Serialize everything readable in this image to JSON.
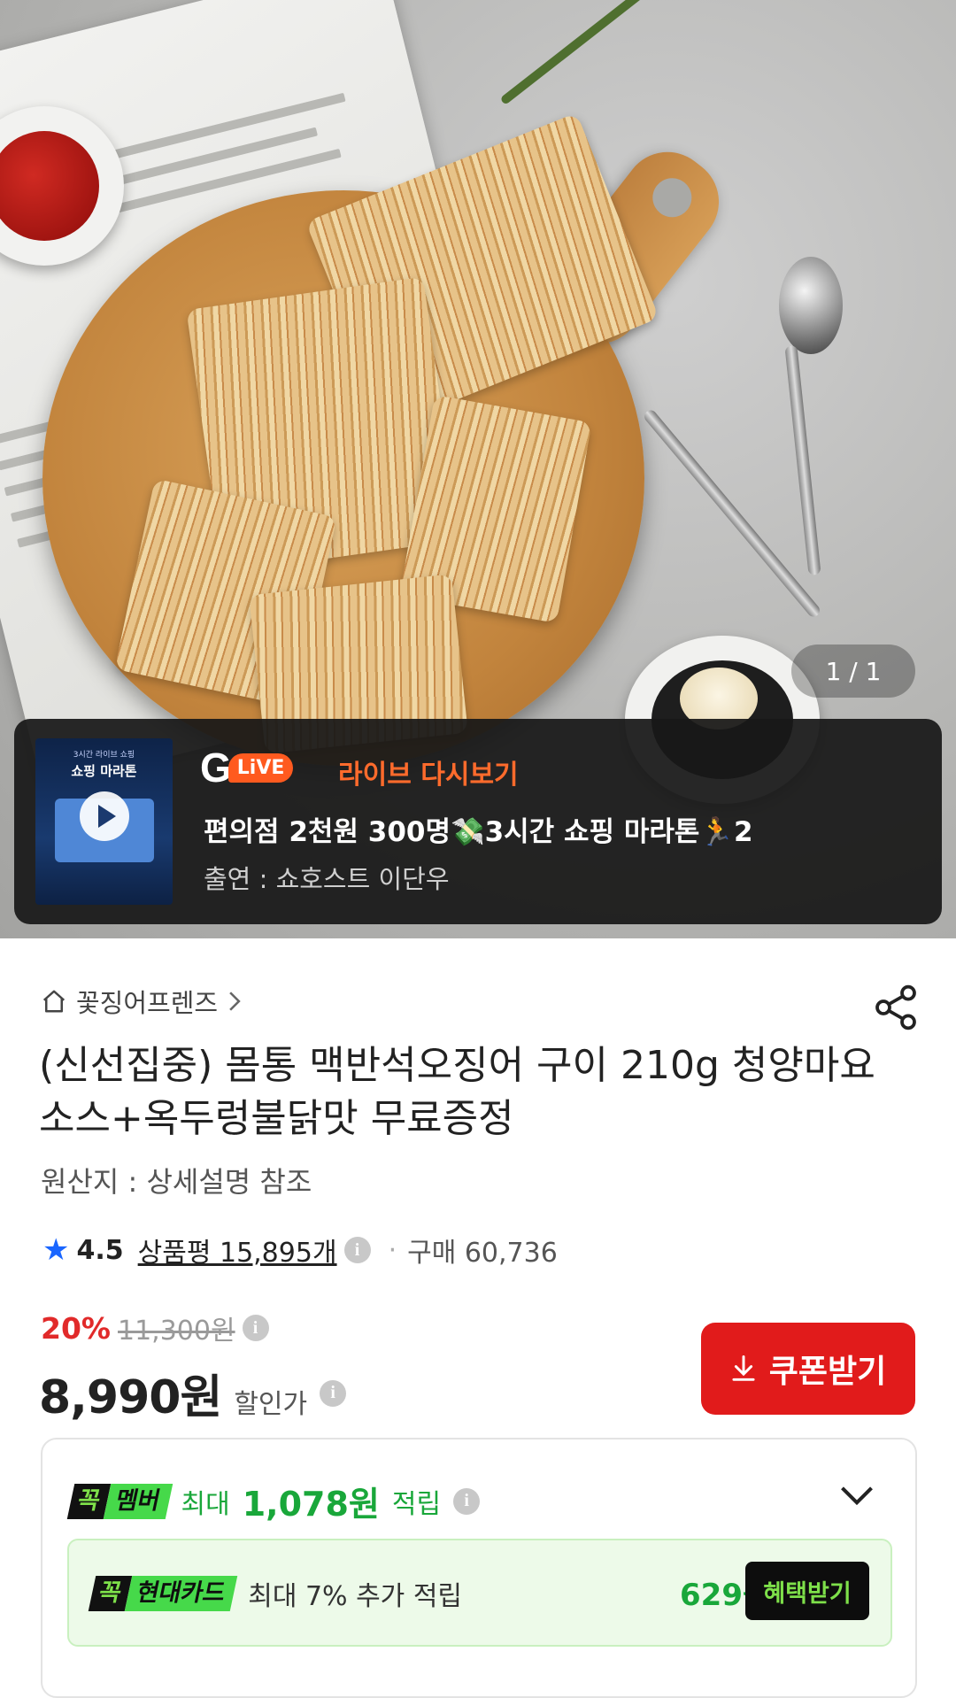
{
  "gallery": {
    "pager": "1 / 1"
  },
  "live": {
    "thumb_title": "쇼핑 마라톤",
    "thumb_sub": "3시간 라이브 쇼핑",
    "logo_g": "G",
    "logo_live": "LiVE",
    "label": "라이브 다시보기",
    "title": "편의점 2천원 300명💸3시간 쇼핑 마라톤🏃2",
    "host": "출연 : 쇼호스트 이단우"
  },
  "product": {
    "store": "꽃징어프렌즈",
    "title": "(신선집중) 몸통 맥반석오징어 구이 210g 청양마요소스+옥두렁불닭맛 무료증정",
    "origin": "원산지 : 상세설명 참조",
    "rating": "4.5",
    "review_label": "상품평 15,895개",
    "purchase_label": "구매 60,736",
    "discount": "20%",
    "original_price": "11,300원",
    "price": "8,990원",
    "price_label": "할인가",
    "coupon_label": "쿠폰받기"
  },
  "benefit": {
    "badge_k": "꼭",
    "badge_member": "멤버",
    "max_label": "최대",
    "points": "1,078원",
    "points_suffix": "적립",
    "card_badge_k": "꼭",
    "card_badge_name": "현대카드",
    "card_text": "최대 7% 추가 적립",
    "card_amount": "629원",
    "card_button": "혜택받기"
  },
  "colors": {
    "accent_red": "#e11b1b",
    "green": "#19a73a",
    "star_blue": "#1a66ff",
    "live_orange": "#ff6b2c"
  },
  "icons": [
    "home-icon",
    "chevron-right-icon",
    "share-icon",
    "star-icon",
    "info-icon",
    "download-icon",
    "chevron-down-icon",
    "play-icon"
  ]
}
